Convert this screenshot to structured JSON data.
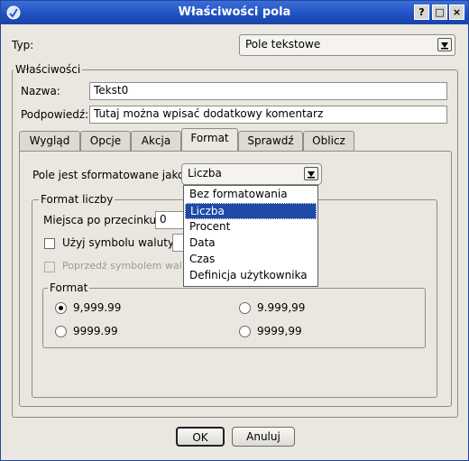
{
  "window": {
    "title": "Właściwości pola"
  },
  "type_row": {
    "label": "Typ:",
    "value": "Pole tekstowe"
  },
  "properties": {
    "legend": "Właściwości",
    "name_label": "Nazwa:",
    "name_value": "Tekst0",
    "tooltip_label": "Podpowiedź:",
    "tooltip_value": "Tutaj można wpisać dodatkowy komentarz"
  },
  "tabs": [
    "Wygląd",
    "Opcje",
    "Akcja",
    "Format",
    "Sprawdź",
    "Oblicz"
  ],
  "format_tab": {
    "format_as_label": "Pole jest sformatowane jako:",
    "format_as_value": "Liczba",
    "dropdown_options": [
      "Bez formatowania",
      "Liczba",
      "Procent",
      "Data",
      "Czas",
      "Definicja użytkownika"
    ],
    "number_group": {
      "legend": "Format liczby",
      "decimals_label": "Miejsca po przecinku:",
      "decimals_value": "0",
      "currency_label": "Użyj symbolu waluty",
      "prepend_label": "Poprzedź symbolem wal"
    },
    "format_group": {
      "legend": "Format",
      "options": [
        "9,999.99",
        "9.999,99",
        "9999.99",
        "9999,99"
      ],
      "selected": "9,999.99"
    }
  },
  "buttons": {
    "ok": "OK",
    "cancel": "Anuluj"
  }
}
